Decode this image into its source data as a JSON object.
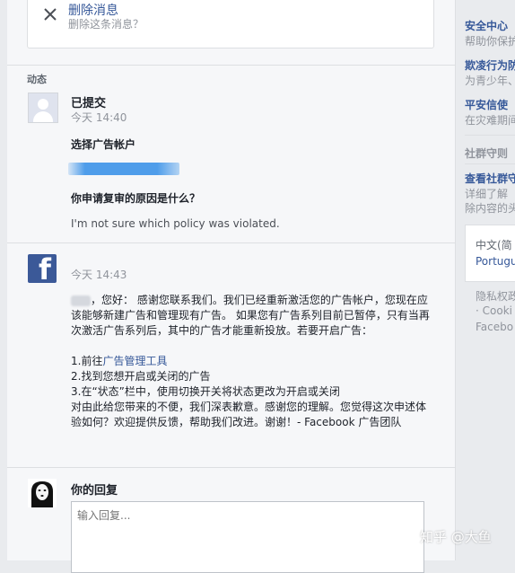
{
  "delete_card": {
    "title": "删除消息",
    "subtitle": "删除这条消息？"
  },
  "section_label": "动态",
  "submission": {
    "name": "已提交",
    "time": "今天 14:40",
    "q_account": "选择广告帐户",
    "q_reason": "你申请复审的原因是什么？",
    "reason_answer": "I'm not sure which policy was violated."
  },
  "facebook_reply": {
    "time": "今天 14:43",
    "para1": "，您好： 感谢您联系我们。我们已经重新激活您的广告帐户，您现在应该能够新建广告和管理现有广告。 如果您有广告系列目前已暂停，只有当再次激活广告系列后，其中的广告才能重新投放。若要开启广告：",
    "step1_prefix": "1.前往",
    "step1_link": "广告管理工具",
    "step2": "2.找到您想开启或关闭的广告",
    "step3": "3.在“状态”栏中，使用切换开关将状态更改为开启或关闭",
    "para2": "对由此给您带来的不便，我们深表歉意。感谢您的理解。您觉得这次申述体验如何？欢迎提供反馈，帮助我们改进。谢谢！- Facebook 广告团队"
  },
  "your_reply": {
    "label": "你的回复",
    "placeholder": "输入回复..."
  },
  "sidebar": {
    "link1": "安全中心",
    "sub1": "帮助你保护",
    "link2": "欺凌行为防",
    "sub2": "为青少年、",
    "link3": "平安信使",
    "sub3": "在灾难期间",
    "head4": "社群守则",
    "link4": "查看社群守",
    "sub4a": "详细了解",
    "sub4b": "除内容的头",
    "lang1": "中文(简",
    "lang2": "Portugu",
    "foot1": "隐私权政",
    "foot2": "· Cooki",
    "foot3": "Facebo"
  },
  "watermark": "知乎 @大鱼",
  "colors": {
    "link": "#365899",
    "facebook_blue": "#3b5998",
    "background": "#e9ebee"
  }
}
